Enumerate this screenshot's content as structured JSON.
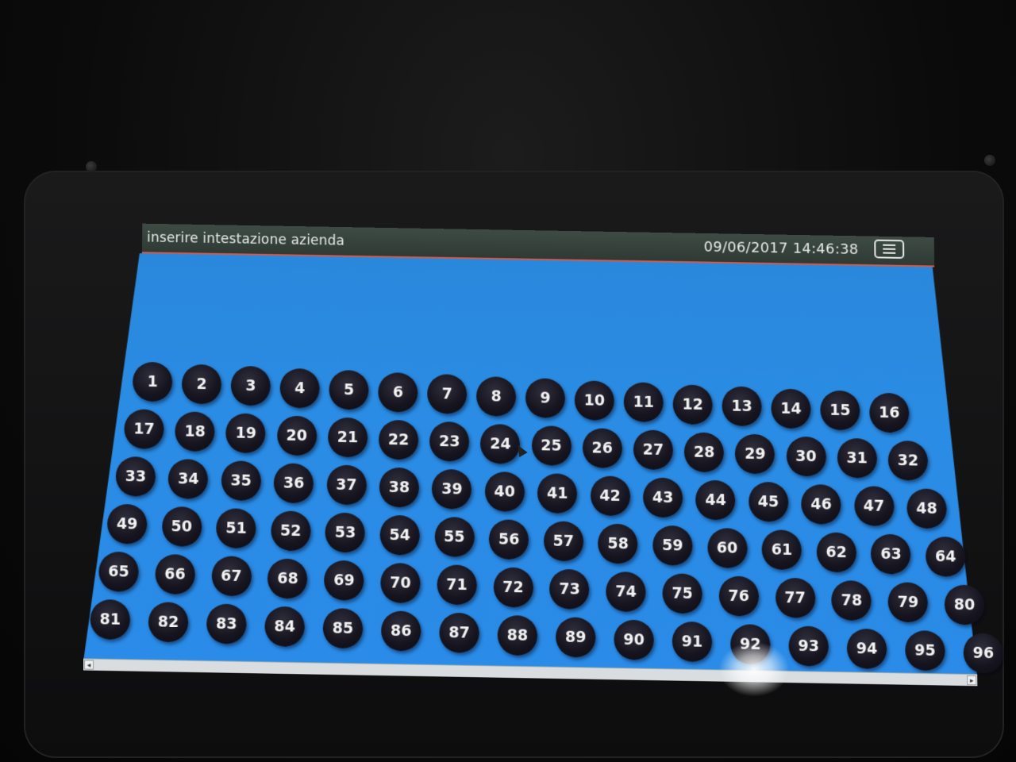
{
  "header": {
    "company_title": "inserire intestazione azienda",
    "datetime": "09/06/2017 14:46:38",
    "menu_icon": "hamburger-icon"
  },
  "colors": {
    "header_bg": "#323d38",
    "header_accent": "#d35a4a",
    "screen_blue": "#2a8be4",
    "ball_dark": "#16151f",
    "ball_text": "#f2f2f2"
  },
  "scrollbar": {
    "left_icon": "arrow-left-icon",
    "right_icon": "arrow-right-icon"
  },
  "buttons": [
    "1",
    "2",
    "3",
    "4",
    "5",
    "6",
    "7",
    "8",
    "9",
    "10",
    "11",
    "12",
    "13",
    "14",
    "15",
    "16",
    "17",
    "18",
    "19",
    "20",
    "21",
    "22",
    "23",
    "24",
    "25",
    "26",
    "27",
    "28",
    "29",
    "30",
    "31",
    "32",
    "33",
    "34",
    "35",
    "36",
    "37",
    "38",
    "39",
    "40",
    "41",
    "42",
    "43",
    "44",
    "45",
    "46",
    "47",
    "48",
    "49",
    "50",
    "51",
    "52",
    "53",
    "54",
    "55",
    "56",
    "57",
    "58",
    "59",
    "60",
    "61",
    "62",
    "63",
    "64",
    "65",
    "66",
    "67",
    "68",
    "69",
    "70",
    "71",
    "72",
    "73",
    "74",
    "75",
    "76",
    "77",
    "78",
    "79",
    "80",
    "81",
    "82",
    "83",
    "84",
    "85",
    "86",
    "87",
    "88",
    "89",
    "90",
    "91",
    "92",
    "93",
    "94",
    "95",
    "96"
  ]
}
